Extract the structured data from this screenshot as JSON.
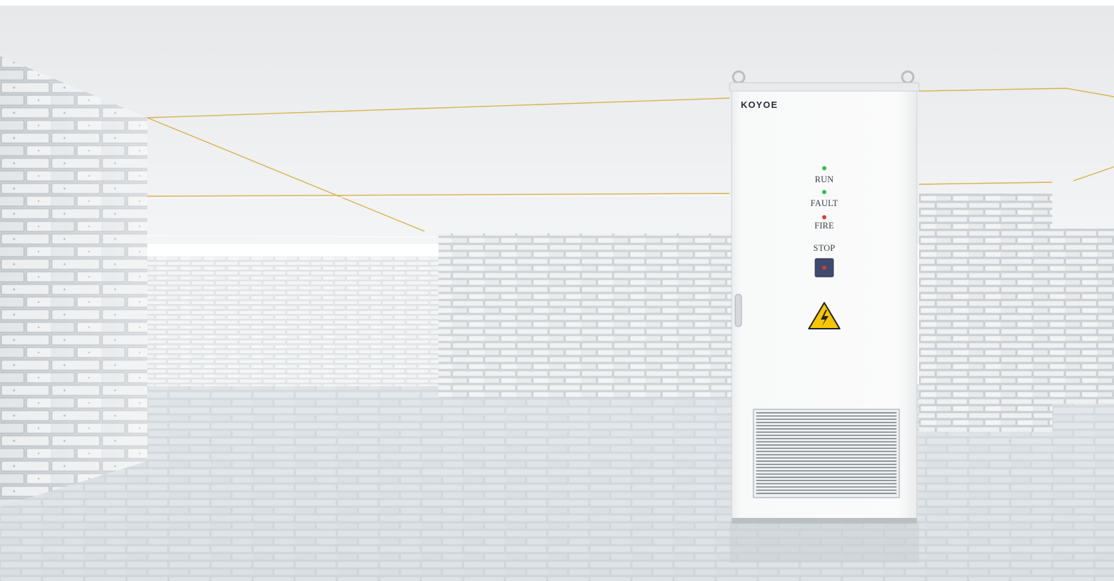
{
  "cabinet": {
    "brand": "KOYOE",
    "indicators": [
      {
        "label": "RUN",
        "led_color": "#2fbf4a"
      },
      {
        "label": "FAULT",
        "led_color": "#2fbf4a"
      },
      {
        "label": "FIRE",
        "led_color": "#e23a2e"
      }
    ],
    "stop_label": "STOP",
    "warning_sign": "high-voltage-warning-icon"
  },
  "colors": {
    "accent_line": "#d9b34a",
    "cabinet_body": "#f7f8f8",
    "warning_yellow": "#f6c700"
  }
}
